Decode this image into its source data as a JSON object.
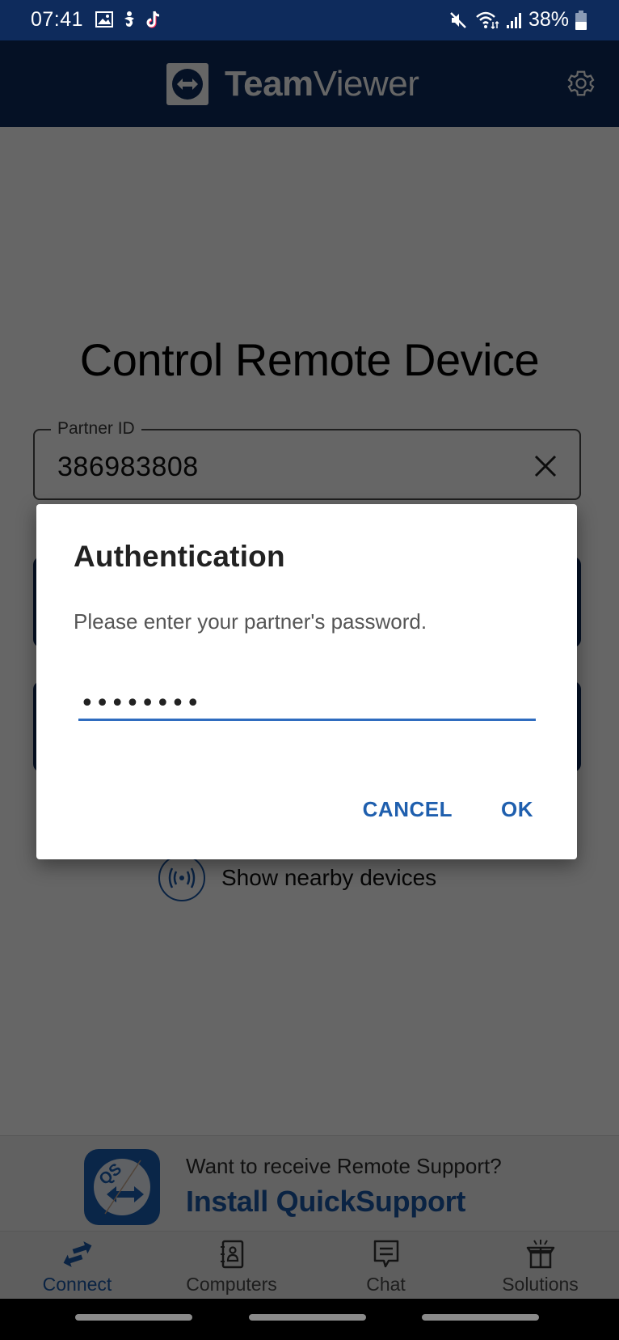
{
  "status_bar": {
    "time": "07:41",
    "left_icons": [
      "gallery-icon",
      "accessibility-icon",
      "tiktok-icon"
    ],
    "right_icons": [
      "mute-icon",
      "wifi-icon",
      "signal-icon"
    ],
    "battery_percent": "38%"
  },
  "app_bar": {
    "brand_bold": "Team",
    "brand_light": "Viewer",
    "settings_icon": "gear-icon"
  },
  "main": {
    "title": "Control Remote Device",
    "partner_id": {
      "label": "Partner ID",
      "value": "386983808"
    },
    "nearby_label": "Show nearby devices"
  },
  "promo": {
    "question": "Want to receive Remote Support?",
    "action": "Install QuickSupport",
    "icon_text": "QS"
  },
  "bottom_nav": {
    "items": [
      {
        "label": "Connect",
        "icon": "connect-arrows-icon",
        "active": true
      },
      {
        "label": "Computers",
        "icon": "contacts-book-icon",
        "active": false
      },
      {
        "label": "Chat",
        "icon": "chat-bubble-icon",
        "active": false
      },
      {
        "label": "Solutions",
        "icon": "gift-box-icon",
        "active": false
      }
    ]
  },
  "dialog": {
    "title": "Authentication",
    "message": "Please enter your partner's password.",
    "password_masked": "••••••••",
    "cancel_label": "CANCEL",
    "ok_label": "OK"
  },
  "colors": {
    "brand_navy": "#0e2b5c",
    "accent_blue": "#1a58a8",
    "dialog_button": "#1f5fae",
    "input_underline": "#2f6cbf"
  }
}
